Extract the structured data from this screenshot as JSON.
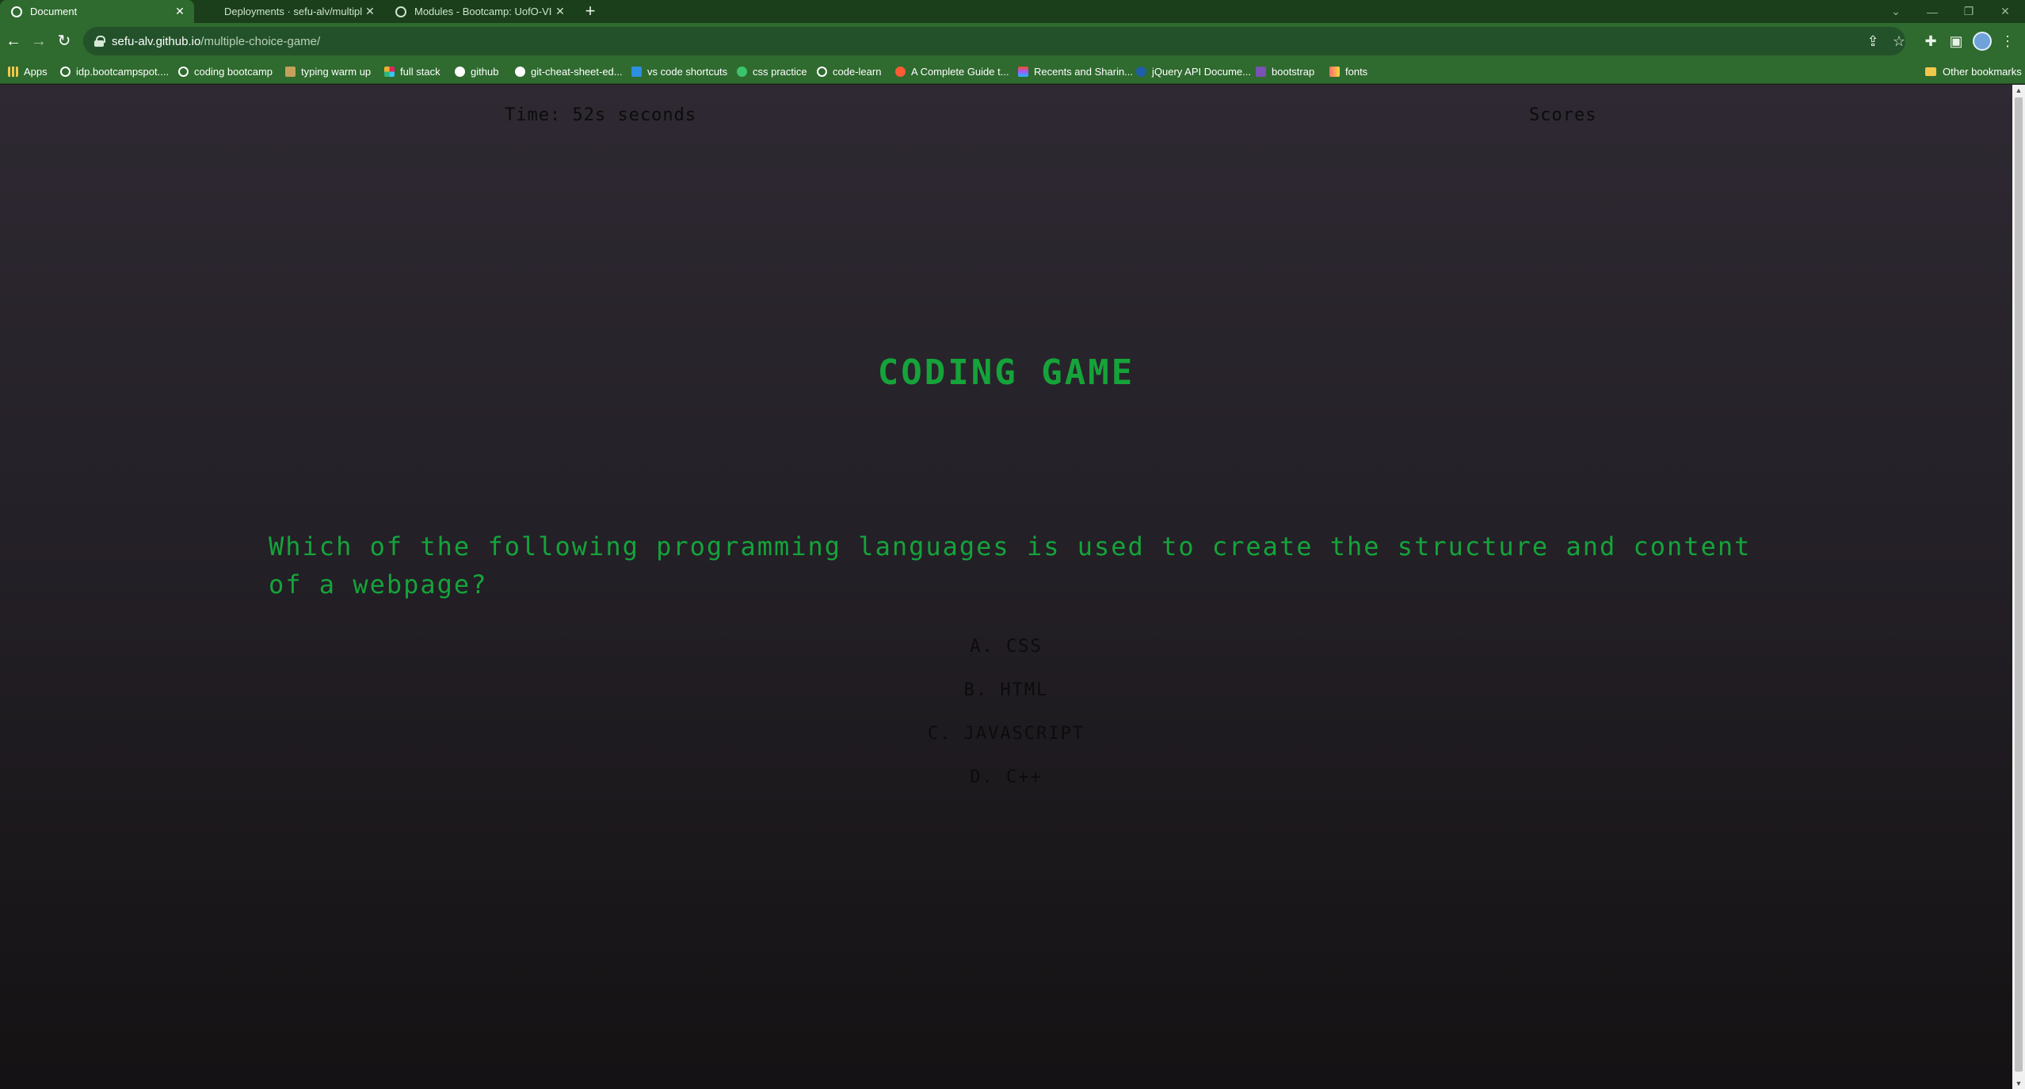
{
  "browser": {
    "tabs": [
      {
        "title": "Document",
        "active": true
      },
      {
        "title": "Deployments · sefu-alv/multiple-",
        "active": false
      },
      {
        "title": "Modules - Bootcamp: UofO-VIRT",
        "active": false
      }
    ],
    "new_tab": "+",
    "url_host": "sefu-alv.github.io",
    "url_path": "/multiple-choice-game/",
    "bookmarks": [
      {
        "label": "Apps",
        "icon": "apps-grid-icon",
        "color": "#ffffff"
      },
      {
        "label": "idp.bootcampspot....",
        "icon": "globe-icon",
        "color": "#ffffff"
      },
      {
        "label": "coding bootcamp",
        "icon": "globe-icon",
        "color": "#ffffff"
      },
      {
        "label": "typing warm up",
        "icon": "typing-icon",
        "color": "#c5a15a"
      },
      {
        "label": "full stack",
        "icon": "slack-icon",
        "color": "#e0245e"
      },
      {
        "label": "github",
        "icon": "github-icon",
        "color": "#ffffff"
      },
      {
        "label": "git-cheat-sheet-ed...",
        "icon": "github-icon",
        "color": "#ffffff"
      },
      {
        "label": "vs code shortcuts",
        "icon": "vscode-icon",
        "color": "#2d8fe0"
      },
      {
        "label": "css practice",
        "icon": "frog-icon",
        "color": "#3cc46b"
      },
      {
        "label": "code-learn",
        "icon": "globe-icon",
        "color": "#ffffff"
      },
      {
        "label": "A Complete Guide t...",
        "icon": "star-burst-icon",
        "color": "#ff5a36"
      },
      {
        "label": "Recents and Sharin...",
        "icon": "figma-icon",
        "color": "#f24e1e"
      },
      {
        "label": "jQuery API Docume...",
        "icon": "jquery-icon",
        "color": "#1e5fa8"
      },
      {
        "label": "bootstrap",
        "icon": "bootstrap-icon",
        "color": "#7952b3"
      },
      {
        "label": "fonts",
        "icon": "fonts-icon",
        "color": "#ff6b6b"
      }
    ],
    "other_bookmarks": "Other bookmarks"
  },
  "game": {
    "timer_text": "Time: 52s seconds",
    "scores_label": "Scores",
    "title": "CODING GAME",
    "question": "Which of the following programming languages is used to create the structure and content of a webpage?",
    "answers": [
      "A. CSS",
      "B. HTML",
      "C. JAVASCRIPT",
      "D. C++"
    ],
    "accent_color": "#15a33a"
  }
}
